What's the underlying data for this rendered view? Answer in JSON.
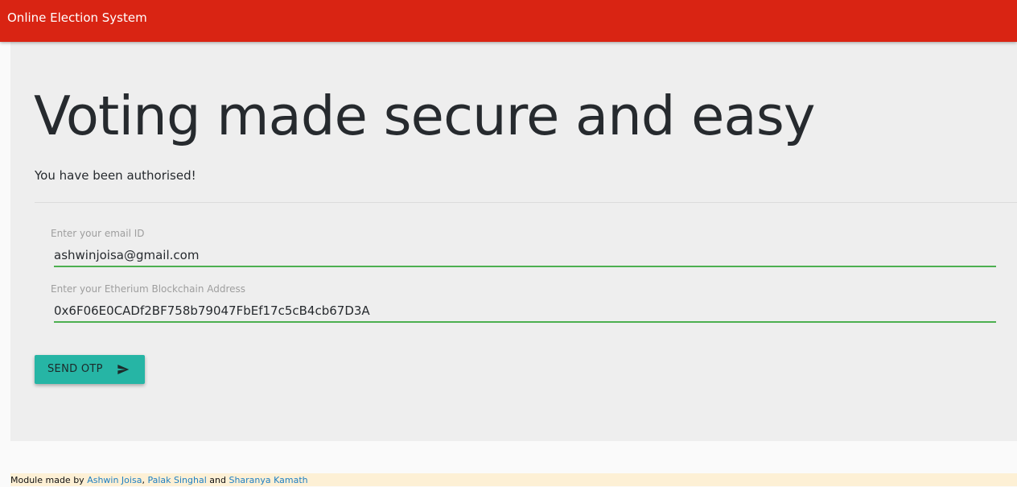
{
  "navbar": {
    "brand": "Online Election System",
    "background_color": "#d92413"
  },
  "hero": {
    "title": "Voting made secure and easy",
    "status": "You have been authorised!"
  },
  "form": {
    "email": {
      "label": "Enter your email ID",
      "value": "ashwinjoisa@gmail.com"
    },
    "address": {
      "label": "Enter your Etherium Blockchain Address",
      "value": "0x6F06E0CADf2BF758b79047FbEf17c5cB4cb67D3A"
    },
    "valid_color": "#4caf50",
    "submit_label": "SEND OTP",
    "submit_icon": "send-icon",
    "submit_color": "#26b5a5"
  },
  "footer": {
    "prefix": "Module made by ",
    "authors": [
      "Ashwin Joisa",
      "Palak Singhal",
      "Sharanya Kamath"
    ],
    "sep_comma": ", ",
    "sep_and": " and ",
    "link_color": "#1e7fc2"
  }
}
